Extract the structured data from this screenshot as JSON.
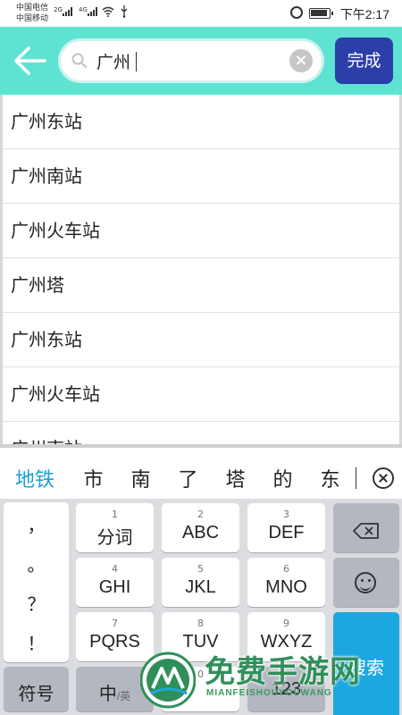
{
  "status_bar": {
    "carrier_1": "中国电信",
    "carrier_2": "中国移动",
    "net_1": "2G",
    "net_2": "4G",
    "time": "下午2:17"
  },
  "header": {
    "search": {
      "value": "广州"
    },
    "done_label": "完成",
    "accent_color": "#5ee3d3",
    "button_color": "#2c3ea8"
  },
  "suggestions": [
    "广州东站",
    "广州南站",
    "广州火车站",
    "广州塔",
    "广州东站",
    "广州火车站",
    "广州南站"
  ],
  "ime": {
    "candidates": [
      "地铁",
      "市",
      "南",
      "了",
      "塔",
      "的",
      "东"
    ],
    "punctuation": [
      "，",
      "。",
      "？",
      "！"
    ],
    "keys": [
      {
        "num": "1",
        "label": "分词"
      },
      {
        "num": "2",
        "label": "ABC"
      },
      {
        "num": "3",
        "label": "DEF"
      },
      {
        "num": "4",
        "label": "GHI"
      },
      {
        "num": "5",
        "label": "JKL"
      },
      {
        "num": "6",
        "label": "MNO"
      },
      {
        "num": "7",
        "label": "PQRS"
      },
      {
        "num": "8",
        "label": "TUV"
      },
      {
        "num": "9",
        "label": "WXYZ"
      }
    ],
    "bottom": {
      "symbols": "符号",
      "lang": "中",
      "lang_alt": "/英",
      "zero": "0",
      "numbers": "123"
    },
    "search_label": "搜索"
  },
  "watermark": {
    "title": "免费手游网",
    "subtitle": "MIANFEISHOUYOUWANG"
  }
}
